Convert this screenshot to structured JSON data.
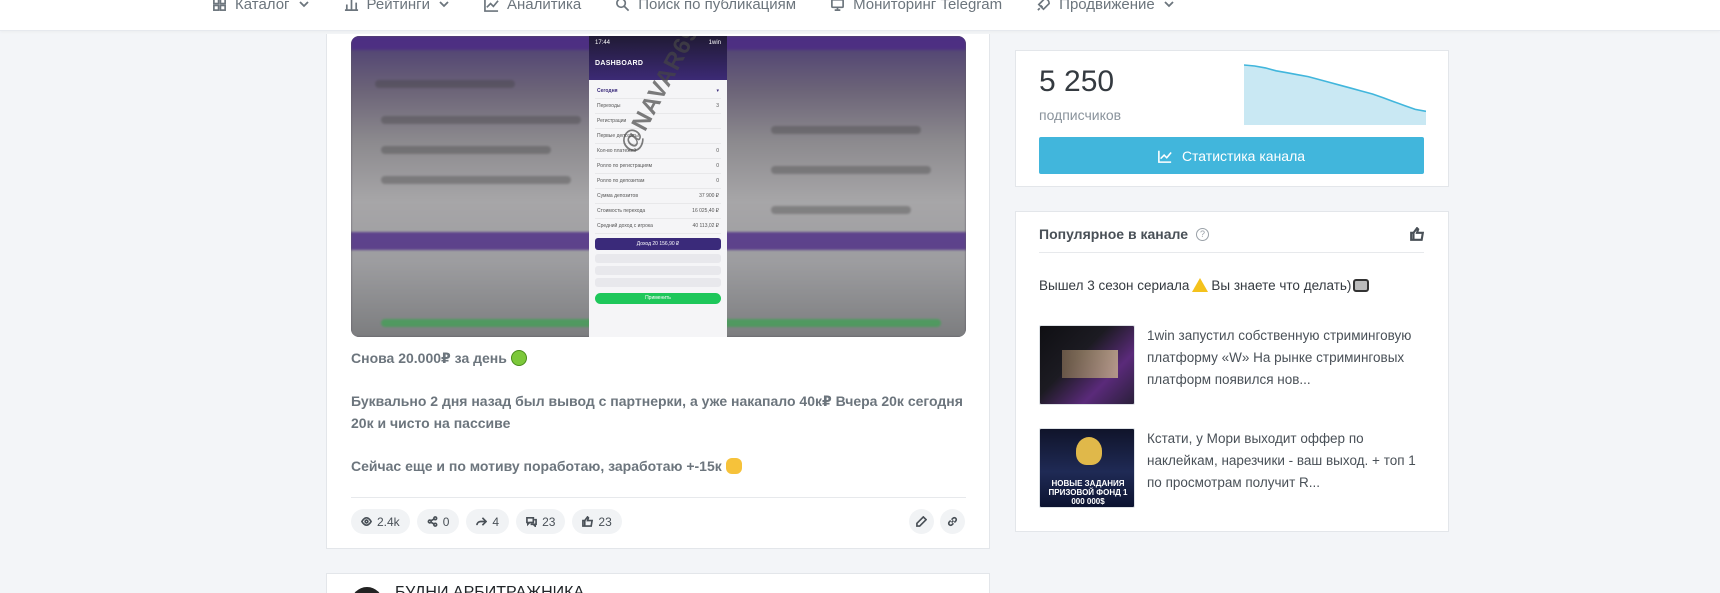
{
  "nav": {
    "items": [
      {
        "label": "Каталог",
        "icon": "grid-icon",
        "dropdown": true
      },
      {
        "label": "Рейтинги",
        "icon": "chart-bars-icon",
        "dropdown": true
      },
      {
        "label": "Аналитика",
        "icon": "chart-line-icon",
        "dropdown": false
      },
      {
        "label": "Поиск по публикациям",
        "icon": "search-icon",
        "dropdown": false
      },
      {
        "label": "Мониторинг Telegram",
        "icon": "monitor-icon",
        "dropdown": false
      },
      {
        "label": "Продвижение",
        "icon": "rocket-icon",
        "dropdown": true
      }
    ]
  },
  "post": {
    "media": {
      "time": "17:44",
      "brand": "1win",
      "header": "DASHBOARD",
      "period": "Сегодня",
      "rows": [
        {
          "label": "Переходы",
          "value": "3"
        },
        {
          "label": "Регистрации",
          "value": ""
        },
        {
          "label": "Первые депозиты",
          "value": ""
        },
        {
          "label": "Кол-во платежей",
          "value": "0"
        },
        {
          "label": "Ролло по регистрациям",
          "value": "0"
        },
        {
          "label": "Ролло по депозитам",
          "value": "0"
        },
        {
          "label": "Сумма депозитов",
          "value": "37 900 ₽"
        },
        {
          "label": "Стоимость перехода",
          "value": "16 025,40 ₽"
        },
        {
          "label": "Средний доход с игрока",
          "value": "40 113,02 ₽"
        }
      ],
      "income": "Доход 20 156,90 ₽",
      "apply": "Применить",
      "watermark": "@NAVAR69"
    },
    "text": [
      "Снова 20.000₽ за день",
      "Буквально 2 дня назад был вывод с партнерки, а уже накапало 40к₽ Вчера 20к сегодня 20к и чисто на пассиве",
      "Сейчас еще и по мотиву поработаю, заработаю +-15к"
    ],
    "stats": {
      "views": "2.4k",
      "shares": "0",
      "forwards": "4",
      "comments": "23",
      "likes": "23"
    }
  },
  "next_post": {
    "title": "БУДНИ АРБИТРАЖНИКА"
  },
  "channel": {
    "subscribers_count": "5 250",
    "subscribers_label": "подписчиков",
    "stats_button": "Статистика канала",
    "sparkline_color": "#41b6dc",
    "sparkline_trend": [
      100,
      99,
      97,
      94,
      92,
      90,
      88,
      85,
      82,
      79,
      76,
      73,
      70,
      66,
      62,
      58,
      54,
      52
    ]
  },
  "popular": {
    "title": "Популярное в канале",
    "featured_text": "Вышел 3 сезон сериала",
    "featured_text_end": "Вы знаете что делать)",
    "items": [
      {
        "text": "1win запустил собственную стриминговую платформу «W» На рынке стриминговых платформ появился нов..."
      },
      {
        "text": "Кстати, у Мори выходит оффер по наклейкам, нарезчики - ваш выход. + топ 1 по просмотрам получит R...",
        "thumb_caption": "НОВЫЕ ЗАДАНИЯ ПРИЗОВОЙ ФОНД 1 000 000$"
      }
    ]
  }
}
